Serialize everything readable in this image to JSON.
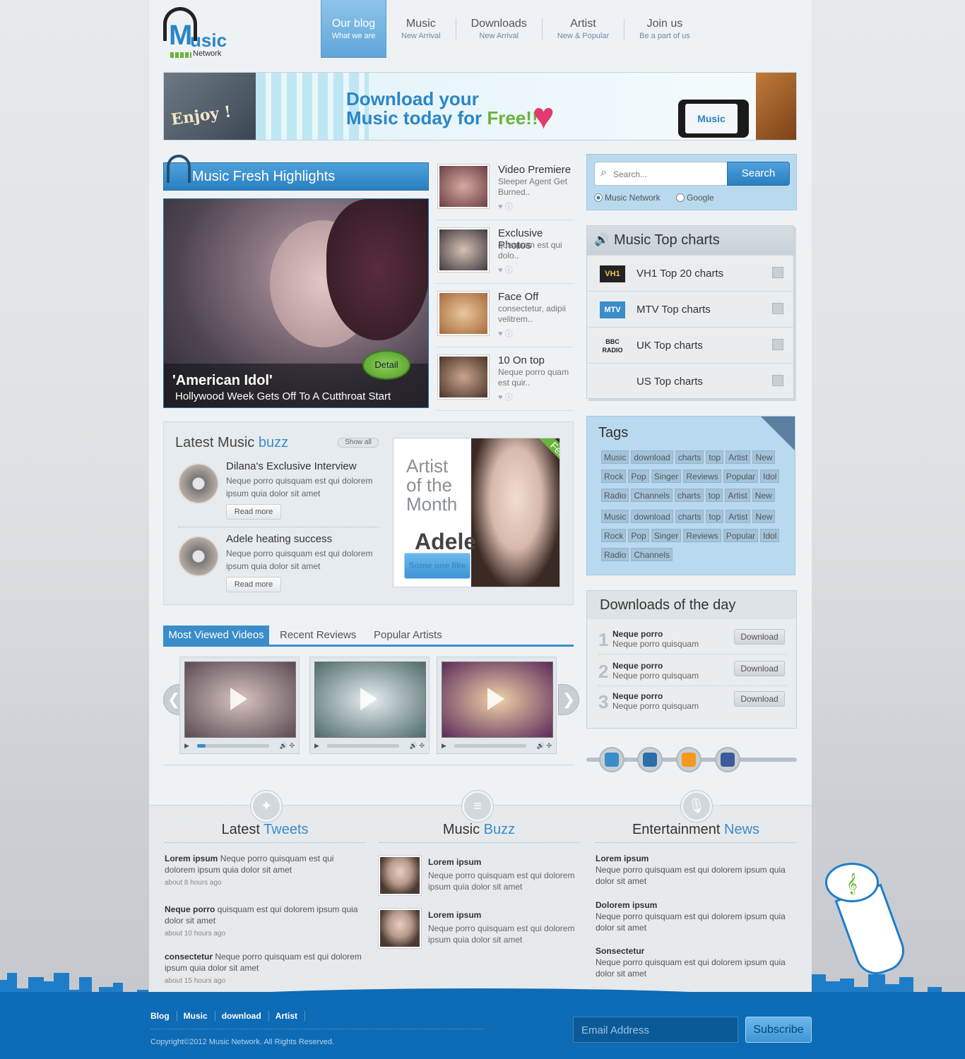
{
  "logo": {
    "word": "Music",
    "sub": "Network"
  },
  "nav": [
    {
      "title": "Our blog",
      "sub": "What we are",
      "active": true
    },
    {
      "title": "Music",
      "sub": "New Arrival"
    },
    {
      "title": "Downloads",
      "sub": "New Arrival"
    },
    {
      "title": "Artist",
      "sub": "New & Popular"
    },
    {
      "title": "Join us",
      "sub": "Be a part of us"
    }
  ],
  "banner": {
    "enjoy": "Enjoy !",
    "line1": "Download your",
    "line2a": "Music today for ",
    "line2b": "Free!!",
    "phone_text": "Music"
  },
  "highlights": {
    "heading": "Music Fresh Highlights",
    "feature_title": "'American Idol'",
    "feature_sub": "Hollywood Week Gets Off To A Cutthroat Start",
    "detail": "Detail",
    "items": [
      {
        "title": "Video Premiere",
        "desc": "Sleeper Agent Get Burned.."
      },
      {
        "title": "Exclusive Photos",
        "desc": "quisquam est qui dolo.."
      },
      {
        "title": "Face Off",
        "desc": "consectetur, adipii velitrem.."
      },
      {
        "title": "10 On top",
        "desc": "Neque porro quam est quir.."
      }
    ]
  },
  "search": {
    "placeholder": "Search...",
    "button": "Search",
    "opt1": "Music Network",
    "opt2": "Google"
  },
  "charts": {
    "heading": "Music Top charts",
    "items": [
      {
        "logo": "VH1",
        "label": "VH1 Top 20 charts"
      },
      {
        "logo": "MTV",
        "label": "MTV Top charts"
      },
      {
        "logo": "BBC RADIO",
        "label": "UK Top charts"
      },
      {
        "logo": "",
        "label": "US Top charts"
      }
    ]
  },
  "tags": {
    "heading": "Tags",
    "rows": [
      [
        "Music",
        "download",
        "charts",
        "top",
        "Artist",
        "New"
      ],
      [
        "Rock",
        "Pop",
        "Singer",
        "Reviews",
        "Popular",
        "Idol"
      ],
      [
        "Radio",
        "Channels",
        "charts",
        "top",
        "Artist",
        "New"
      ],
      [
        "Music",
        "download",
        "charts",
        "top",
        "Artist",
        "New"
      ],
      [
        "Rock",
        "Pop",
        "Singer",
        "Reviews",
        "Popular",
        "Idol"
      ],
      [
        "Radio",
        "Channels"
      ]
    ]
  },
  "downloads": {
    "heading": "Downloads of the day",
    "button": "Download",
    "items": [
      {
        "n": "1",
        "a": "Neque porro",
        "b": "Neque porro quisquam"
      },
      {
        "n": "2",
        "a": "Neque porro",
        "b": "Neque porro quisquam"
      },
      {
        "n": "3",
        "a": "Neque porro",
        "b": "Neque porro quisquam"
      }
    ]
  },
  "buzz": {
    "heading": "Latest Music ",
    "heading_accent": "buzz",
    "show_all": "Show all",
    "read_more": "Read more",
    "items": [
      {
        "title": "Dilana's Exclusive Interview",
        "desc": "Neque porro quisquam est qui dolorem ipsum quia dolor sit amet"
      },
      {
        "title": "Adele heating success",
        "desc": "Neque porro quisquam est qui dolorem ipsum quia dolor sit amet"
      }
    ],
    "artist": {
      "l1": "Artist",
      "l2": "of the",
      "l3": "Month",
      "name": "Adele",
      "sub": "Some one like you",
      "month": "Feb"
    }
  },
  "tabs": [
    "Most Viewed Videos",
    "Recent Reviews",
    "Popular Artists"
  ],
  "videos": [
    {
      "progress": 0.12
    },
    {
      "progress": 0
    },
    {
      "progress": 0
    }
  ],
  "tweets": {
    "h1": "Latest ",
    "h2": "Tweets",
    "items": [
      {
        "b": "Lorem ipsum",
        "t": " Neque porro quisquam est qui dolorem ipsum quia dolor sit amet",
        "ago": "about 8 hours ago"
      },
      {
        "b": "Neque porro",
        "t": "  quisquam est qui dolorem ipsum quia dolor sit amet",
        "ago": "about 10 hours ago"
      },
      {
        "b": "consectetur",
        "t": " Neque porro quisquam est qui dolorem ipsum quia dolor sit amet",
        "ago": "about 15 hours ago"
      }
    ]
  },
  "music_buzz": {
    "h1": "Music ",
    "h2": "Buzz",
    "items": [
      {
        "t": "Lorem ipsum",
        "d": "Neque porro quisquam est qui dolorem ipsum quia dolor sit amet"
      },
      {
        "t": "Lorem ipsum",
        "d": "Neque porro quisquam est qui dolorem ipsum quia dolor sit amet"
      }
    ]
  },
  "news": {
    "h1": "Entertainment ",
    "h2": "News",
    "items": [
      {
        "t": "Lorem ipsum",
        "d": "Neque porro quisquam est qui dolorem ipsum quia dolor sit amet"
      },
      {
        "t": "Dolorem ipsum",
        "d": "Neque porro quisquam est qui dolorem ipsum quia dolor sit amet"
      },
      {
        "t": "Sonsectetur",
        "d": "Neque porro quisquam est qui dolorem ipsum quia dolor sit amet"
      }
    ]
  },
  "footer": {
    "links": [
      "Blog",
      "Music",
      "download",
      "Artist"
    ],
    "copyright": "Copyright©2012 Music Network. All Rights Reserved.",
    "email_placeholder": "Email Address",
    "subscribe": "Subscribe"
  }
}
